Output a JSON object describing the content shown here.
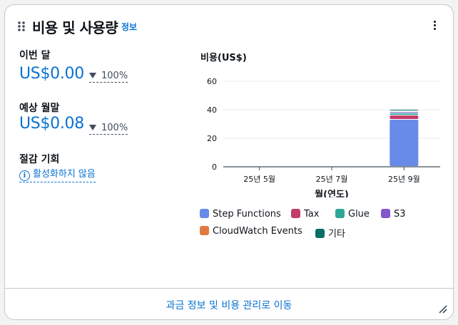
{
  "widget": {
    "title": "비용 및 사용량",
    "info_link": "정보",
    "icons": {
      "drag": "drag-handle-icon",
      "menu": "kebab-menu-icon",
      "resize": "resize-handle-icon",
      "info": "info-circle-icon",
      "trend": "caret-down-icon"
    }
  },
  "metrics": {
    "current_month": {
      "label": "이번 달",
      "value": "US$0.00",
      "change": "100%"
    },
    "forecast": {
      "label": "예상 월말",
      "value": "US$0.08",
      "change": "100%"
    },
    "savings": {
      "label": "절감 기회",
      "link": "활성화하지 않음"
    }
  },
  "chart_data": {
    "type": "bar",
    "stacked": true,
    "title": "비용(US$)",
    "xlabel": "월(연도)",
    "ylabel": "",
    "categories": [
      "25년 5월",
      "25년 7월",
      "25년 9월"
    ],
    "yticks": [
      0,
      20,
      40,
      60
    ],
    "ylim": [
      0,
      60
    ],
    "grid": true,
    "series": [
      {
        "name": "Step Functions",
        "color": "#688ae8",
        "values": [
          0,
          0,
          33
        ]
      },
      {
        "name": "Tax",
        "color": "#c33d69",
        "values": [
          0,
          0,
          3
        ]
      },
      {
        "name": "Glue",
        "color": "#2ea597",
        "values": [
          0,
          0,
          1.5
        ]
      },
      {
        "name": "S3",
        "color": "#8456ce",
        "values": [
          0,
          0,
          1
        ]
      },
      {
        "name": "CloudWatch Events",
        "color": "#e07941",
        "values": [
          0,
          0,
          0.5
        ]
      },
      {
        "name": "기타",
        "color": "#096f64",
        "values": [
          0,
          0,
          1
        ]
      }
    ],
    "legend_position": "bottom"
  },
  "footer": {
    "link": "과금 정보 및 비용 관리로 이동"
  }
}
